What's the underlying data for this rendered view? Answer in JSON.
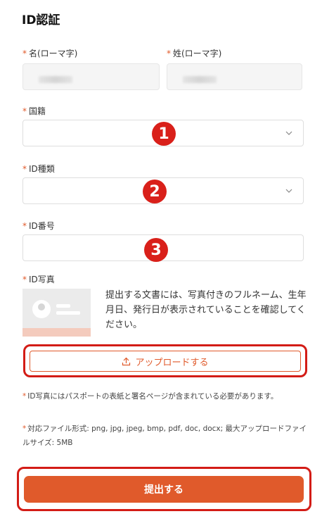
{
  "page": {
    "title": "ID認証"
  },
  "form": {
    "required_mark": "*",
    "first_name_label": "名(ローマ字)",
    "last_name_label": "姓(ローマ字)",
    "nationality_label": "国籍",
    "id_type_label": "ID種類",
    "id_number_label": "ID番号",
    "id_photo_label": "ID写真",
    "photo_description": "提出する文書には、写真付きのフルネーム、生年月日、発行日が表示されていることを確認してください。",
    "upload_label": "アップロードする",
    "submit_label": "提出する"
  },
  "notes": [
    "ID写真にはパスポートの表紙と署名ページが含まれている必要があります。",
    "対応ファイル形式: png, jpg, jpeg, bmp, pdf, doc, docx; 最大アップロードファイルサイズ: 5MB"
  ],
  "annotations": {
    "badge_1": "1",
    "badge_2": "2",
    "badge_3": "3"
  },
  "colors": {
    "accent": "#e05a2b",
    "highlight": "#d31c16"
  },
  "icons": {
    "dropdown": "chevron-down-icon",
    "upload": "upload-icon"
  }
}
